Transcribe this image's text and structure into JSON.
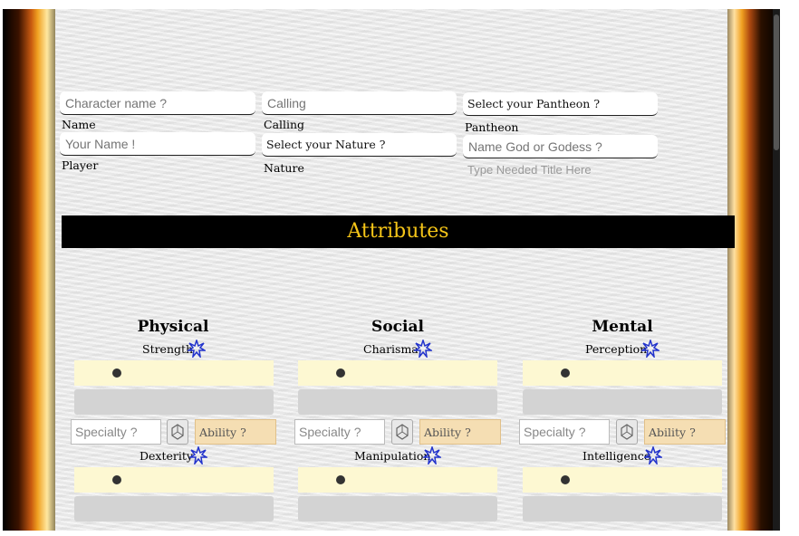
{
  "identity": {
    "character_name_placeholder": "Character name ?",
    "name_label": "Name",
    "player_placeholder": "Your Name !",
    "player_label": "Player",
    "calling_placeholder": "Calling",
    "calling_label": "Calling",
    "nature_select": "Select your Nature ?",
    "nature_label": "Nature",
    "pantheon_select": "Select your Pantheon ?",
    "pantheon_label": "Pantheon",
    "god_placeholder": "Name God or Godess ?",
    "title_placeholder": "Type Needed Title Here"
  },
  "attributes": {
    "header": "Attributes",
    "columns": [
      {
        "heading": "Physical",
        "stats": [
          "Strength",
          "Dexterity"
        ]
      },
      {
        "heading": "Social",
        "stats": [
          "Charisma",
          "Manipulation"
        ]
      },
      {
        "heading": "Mental",
        "stats": [
          "Perception",
          "Intelligence"
        ]
      }
    ],
    "specialty_placeholder": "Specialty ?",
    "ability_placeholder": "Ability ?"
  },
  "colors": {
    "header_bg": "#000000",
    "header_text": "#f5c518",
    "dots_bg": "#fdf8d2",
    "ability_bg": "#f5deb3",
    "star": "#2233cc"
  },
  "icons": {
    "star": "star-burst-icon",
    "dice": "dice-icon"
  }
}
